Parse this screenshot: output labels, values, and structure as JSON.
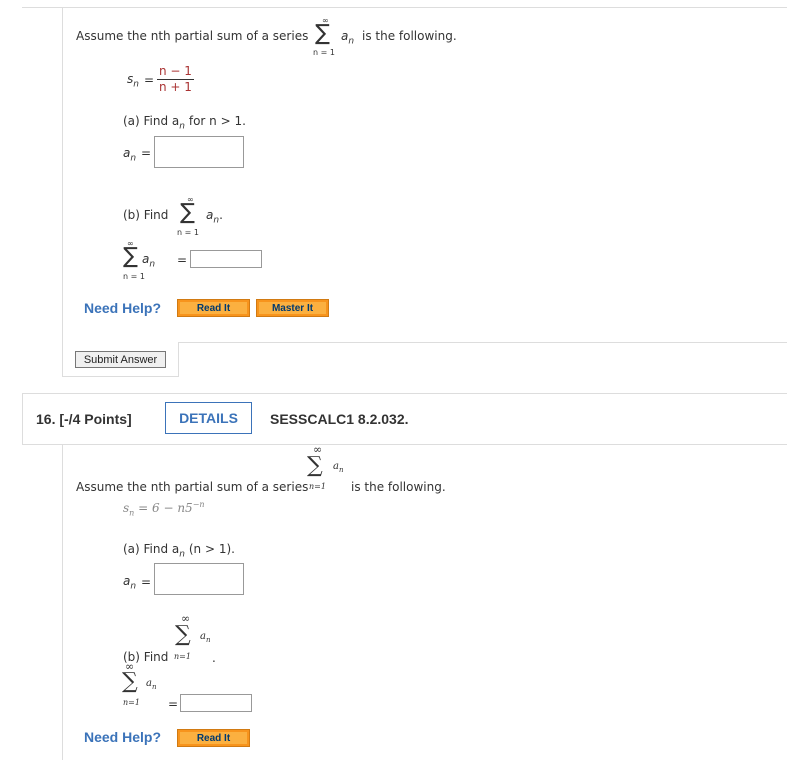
{
  "problem15": {
    "intro_prefix": "Assume the nth partial sum of a series",
    "intro_suffix": "is the following.",
    "sigma": "∑",
    "inf": "∞",
    "n_eq_1": "n = 1",
    "a_n": "a",
    "n_sub": "n",
    "s": "s",
    "eq": "=",
    "num": "n − 1",
    "den": "n + 1",
    "part_a": "(a) Find a",
    "part_a_rest": "for n > 1.",
    "an_label": "a",
    "part_b": "(b) Find",
    "part_b_period": ".",
    "need_help": "Need Help?",
    "read_it": "Read It",
    "master_it": "Master It",
    "submit": "Submit Answer"
  },
  "problem16": {
    "number": "16.",
    "points": "[-/4 Points]",
    "details": "DETAILS",
    "code": "SESSCALC1 8.2.032.",
    "intro_prefix": "Assume the nth partial sum of a series",
    "intro_suffix": "is the following.",
    "sigma": "∑",
    "inf": "∞",
    "n_eq_1": "n=1",
    "a_n": "a",
    "n_sub": "n",
    "formula": "s = 6 − n5",
    "formula_s": "s",
    "formula_n": "n",
    "formula_rest": " = 6 − n5",
    "formula_exp": "−n",
    "part_a": "(a) Find a",
    "part_a_rest": "(n > 1).",
    "part_b": "(b) Find",
    "part_b_period": ".",
    "need_help": "Need Help?",
    "read_it": "Read It"
  },
  "colors": {
    "accent_blue": "#3b73b9",
    "button_orange": "#f7941d",
    "button_text": "#003a70",
    "border_gray": "#dddddd"
  }
}
